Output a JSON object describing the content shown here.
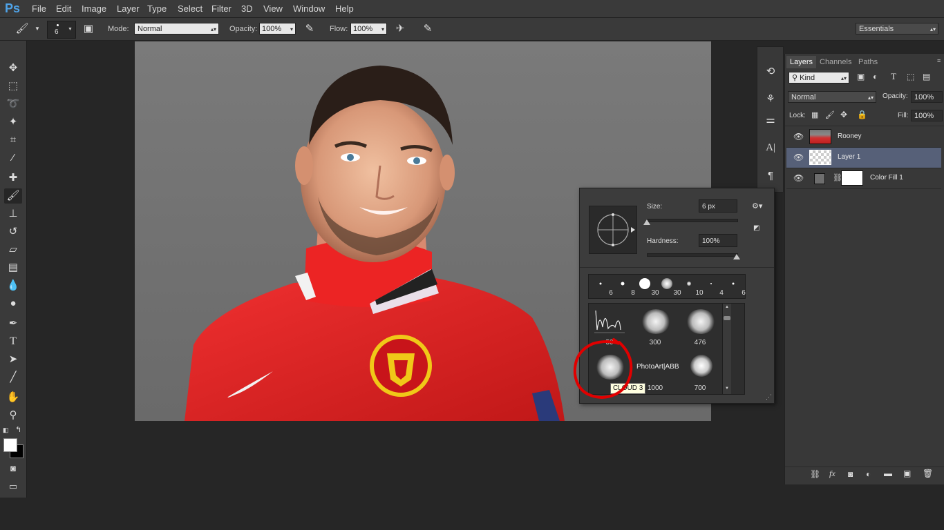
{
  "app": {
    "logo": "Ps"
  },
  "menu": [
    "File",
    "Edit",
    "Image",
    "Layer",
    "Type",
    "Select",
    "Filter",
    "3D",
    "View",
    "Window",
    "Help"
  ],
  "options": {
    "brush_size": "6",
    "mode_label": "Mode:",
    "mode_value": "Normal",
    "opacity_label": "Opacity:",
    "opacity_value": "100%",
    "flow_label": "Flow:",
    "flow_value": "100%",
    "workspace": "Essentials"
  },
  "layers_panel": {
    "tabs": [
      "Layers",
      "Channels",
      "Paths"
    ],
    "kind_label": "Kind",
    "blend_mode": "Normal",
    "opacity_label": "Opacity:",
    "opacity_value": "100%",
    "lock_label": "Lock:",
    "fill_label": "Fill:",
    "fill_value": "100%",
    "layers": [
      {
        "name": "Rooney",
        "visible": true,
        "selected": false
      },
      {
        "name": "Layer 1",
        "visible": true,
        "selected": true
      },
      {
        "name": "Color Fill 1",
        "visible": true,
        "selected": false
      }
    ]
  },
  "brush_picker": {
    "size_label": "Size:",
    "size_value": "6 px",
    "hardness_label": "Hardness:",
    "hardness_value": "100%",
    "size_fraction": 0.0,
    "hardness_fraction": 1.0,
    "presets": [
      "6",
      "8",
      "30",
      "30",
      "10",
      "4",
      "6"
    ],
    "grid": [
      "50",
      "300",
      "476",
      "",
      "1000",
      "700"
    ],
    "grid_text": "PhotoArt|ABB",
    "tooltip": "CLOUD 3"
  },
  "colors": {
    "accent_selection": "#566078",
    "annotation_red": "#e10000"
  }
}
